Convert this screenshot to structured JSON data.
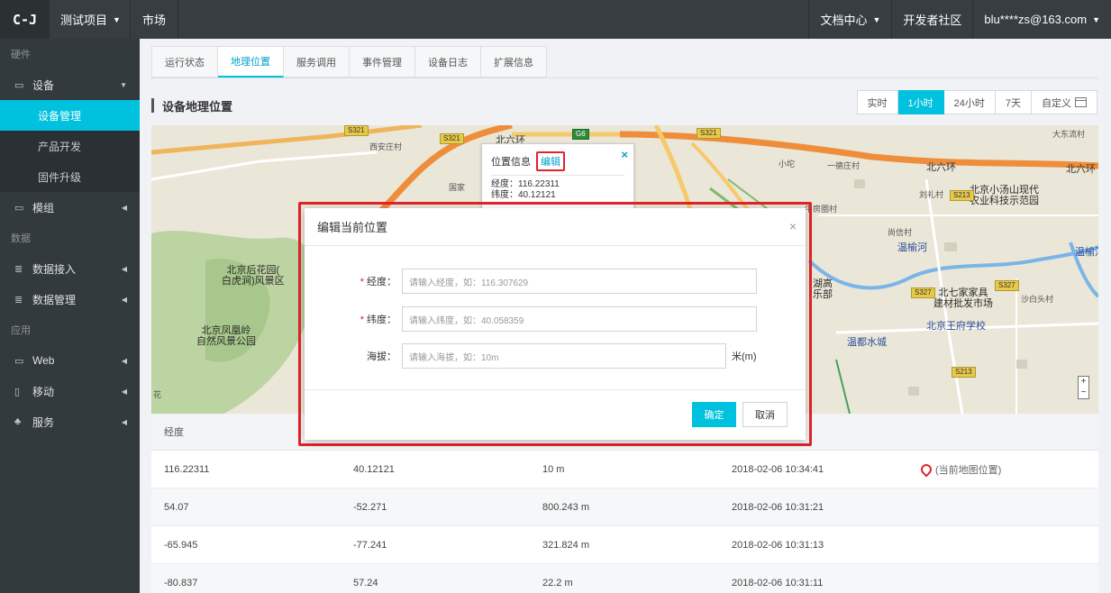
{
  "topbar": {
    "logo": "C-J",
    "project": "测试项目",
    "market": "市场",
    "docs": "文档中心",
    "community": "开发者社区",
    "user": "blu****zs@163.com"
  },
  "sidebar": {
    "sec_hardware": "硬件",
    "device": "设备",
    "device_manage": "设备管理",
    "product_dev": "产品开发",
    "firmware": "固件升级",
    "module": "模组",
    "sec_data": "数据",
    "data_access": "数据接入",
    "data_manage": "数据管理",
    "sec_app": "应用",
    "web": "Web",
    "mobile": "移动",
    "service": "服务"
  },
  "tabs": [
    "运行状态",
    "地理位置",
    "服务调用",
    "事件管理",
    "设备日志",
    "扩展信息"
  ],
  "section_title": "设备地理位置",
  "time_segments": [
    "实时",
    "1小时",
    "24小时",
    "7天",
    "自定义"
  ],
  "map": {
    "labels": {
      "xiananzhuang": "西安庄村",
      "beiliuhuan_top": "北六环",
      "xiaotuo": "小坨",
      "erqizhuang": "一德庄村",
      "beiliuhuan_r": "北六环",
      "beiliuhuan_rr": "北六环",
      "dadongliu": "大东流村",
      "guojia": "国家",
      "liulicun": "刘礼村",
      "niufangquan": "牛房圈村",
      "xiaotangshan": "北京小汤山现代\n农业科技示范园",
      "shanghe": "尚信村",
      "wenyuhe": "温榆河",
      "wenyuhe2": "温榆河",
      "houhuayuan": "北京后花园(\n白虎涧)风景区",
      "fenghuangling": "北京凤凰岭\n自然风景公园",
      "huaigao": "湖高\n乐部",
      "beiqijia": "北七家家具\n建材批发市场",
      "wangfu": "北京王府学校",
      "wendu": "温都水城",
      "shaobaitou": "沙白头村",
      "hua": "花"
    },
    "signs": [
      "S321",
      "S321",
      "G6",
      "S321",
      "S213",
      "S327",
      "S327",
      "S213"
    ],
    "popup": {
      "title": "位置信息",
      "edit": "编辑",
      "close": "×",
      "lng": "经度：116.22311",
      "lat": "纬度：40.12121"
    }
  },
  "table": {
    "header": "经度",
    "rows": [
      [
        "116.22311",
        "40.12121",
        "10 m",
        "2018-02-06 10:34:41",
        "(当前地图位置)"
      ],
      [
        "54.07",
        "-52.271",
        "800.243 m",
        "2018-02-06 10:31:21",
        ""
      ],
      [
        "-65.945",
        "-77.241",
        "321.824 m",
        "2018-02-06 10:31:13",
        ""
      ],
      [
        "-80.837",
        "57.24",
        "22.2 m",
        "2018-02-06 10:31:11",
        ""
      ]
    ]
  },
  "modal": {
    "title": "编辑当前位置",
    "close": "×",
    "lng_label": "经度：",
    "lng_placeholder": "请输入经度，如：116.307629",
    "lat_label": "纬度：",
    "lat_placeholder": "请输入纬度，如：40.058359",
    "alt_label": "海拔：",
    "alt_placeholder": "请输入海拔，如：10m",
    "alt_unit": "米(m)",
    "required_mark": "*",
    "ok": "确定",
    "cancel": "取消"
  },
  "colors": {
    "accent": "#00c1de",
    "highlight": "#e0232a",
    "topbar": "#373d41",
    "sidebar": "#333a3e"
  }
}
